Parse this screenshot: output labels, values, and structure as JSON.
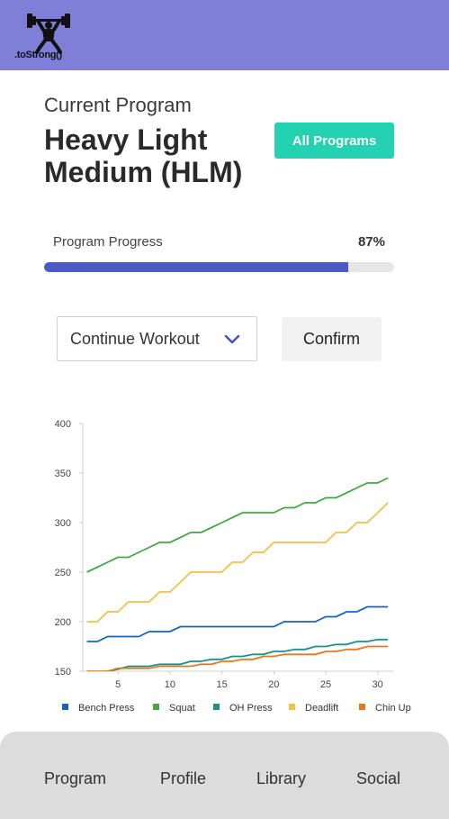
{
  "brand": {
    "name": ".toStrong()",
    "logo_icon": "weightlifter-icon"
  },
  "program": {
    "subtitle": "Current Program",
    "title": "Heavy Light Medium (HLM)",
    "all_programs_label": "All Programs"
  },
  "progress": {
    "label": "Program Progress",
    "value_text": "87%",
    "fraction": 0.87,
    "fill_color": "#4a5bc9"
  },
  "workout": {
    "selected": "Continue Workout",
    "confirm_label": "Confirm"
  },
  "chart_data": {
    "type": "line",
    "x": [
      2,
      3,
      4,
      5,
      6,
      7,
      8,
      9,
      10,
      11,
      12,
      13,
      14,
      15,
      16,
      17,
      18,
      19,
      20,
      21,
      22,
      23,
      24,
      25,
      26,
      27,
      28,
      29,
      30,
      31
    ],
    "xticks": [
      5,
      10,
      15,
      20,
      25,
      30
    ],
    "yticks": [
      150,
      200,
      250,
      300,
      350,
      400
    ],
    "xlim": [
      1.6,
      31.5
    ],
    "ylim": [
      150,
      400
    ],
    "grid": false,
    "legend_position": "bottom",
    "series": [
      {
        "name": "Bench Press",
        "color": "#1565c0",
        "values": [
          180,
          180,
          185,
          185,
          185,
          185,
          190,
          190,
          190,
          195,
          195,
          195,
          195,
          195,
          195,
          195,
          195,
          195,
          195,
          200,
          200,
          200,
          200,
          205,
          205,
          210,
          210,
          215,
          215,
          215
        ]
      },
      {
        "name": "Squat",
        "color": "#43a843",
        "values": [
          250,
          255,
          260,
          265,
          265,
          270,
          275,
          280,
          280,
          285,
          290,
          290,
          295,
          300,
          305,
          310,
          310,
          310,
          310,
          315,
          315,
          320,
          320,
          325,
          325,
          330,
          335,
          340,
          340,
          345
        ]
      },
      {
        "name": "OH Press",
        "color": "#1a9090",
        "values": [
          145,
          148,
          150,
          152,
          155,
          155,
          155,
          157,
          157,
          157,
          160,
          160,
          162,
          162,
          165,
          165,
          167,
          167,
          170,
          170,
          172,
          172,
          175,
          175,
          177,
          177,
          180,
          180,
          182,
          182
        ]
      },
      {
        "name": "Deadlift",
        "color": "#f2c048",
        "values": [
          200,
          200,
          210,
          210,
          220,
          220,
          220,
          230,
          230,
          240,
          250,
          250,
          250,
          250,
          260,
          260,
          270,
          270,
          280,
          280,
          280,
          280,
          280,
          280,
          290,
          290,
          300,
          300,
          310,
          320
        ]
      },
      {
        "name": "Chin Up",
        "color": "#e87820",
        "values": [
          150,
          150,
          150,
          153,
          153,
          153,
          153,
          155,
          155,
          155,
          155,
          157,
          157,
          160,
          160,
          162,
          162,
          165,
          165,
          167,
          167,
          167,
          167,
          170,
          170,
          172,
          172,
          175,
          175,
          175
        ]
      }
    ]
  },
  "nav": {
    "items": [
      "Program",
      "Profile",
      "Library",
      "Social"
    ]
  }
}
